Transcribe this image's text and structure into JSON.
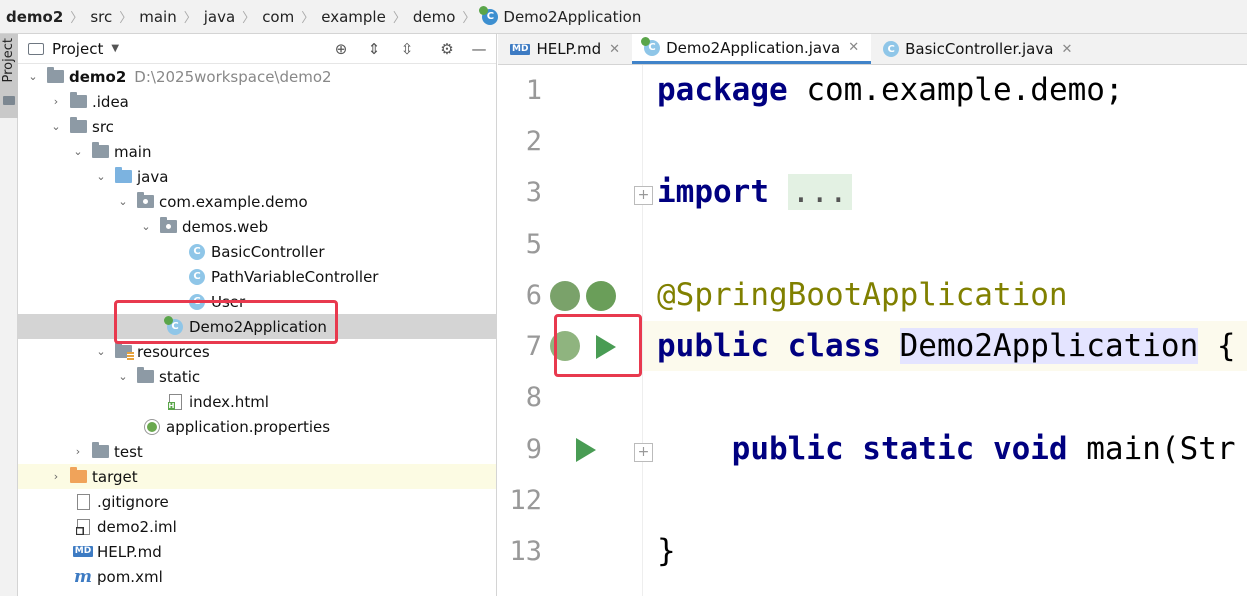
{
  "breadcrumb": [
    "demo2",
    "src",
    "main",
    "java",
    "com",
    "example",
    "demo",
    "Demo2Application"
  ],
  "tool_stripe": {
    "project_tab_label": "Project"
  },
  "project_panel": {
    "title": "Project",
    "tree": [
      {
        "label": "demo2",
        "path": "D:\\2025workspace\\demo2",
        "icon": "folder-icon",
        "expanded": true
      },
      {
        "label": ".idea",
        "icon": "folder-icon",
        "expanded": false
      },
      {
        "label": "src",
        "icon": "folder-icon",
        "expanded": true
      },
      {
        "label": "main",
        "icon": "folder-icon",
        "expanded": true
      },
      {
        "label": "java",
        "icon": "source-folder-icon",
        "expanded": true
      },
      {
        "label": "com.example.demo",
        "icon": "package-icon",
        "expanded": true
      },
      {
        "label": "demos.web",
        "icon": "package-icon",
        "expanded": true
      },
      {
        "label": "BasicController",
        "icon": "class-icon"
      },
      {
        "label": "PathVariableController",
        "icon": "class-icon"
      },
      {
        "label": "User",
        "icon": "class-icon"
      },
      {
        "label": "Demo2Application",
        "icon": "spring-class-icon",
        "selected": true
      },
      {
        "label": "resources",
        "icon": "resources-folder-icon",
        "expanded": true
      },
      {
        "label": "static",
        "icon": "folder-icon",
        "expanded": true
      },
      {
        "label": "index.html",
        "icon": "html-file-icon"
      },
      {
        "label": "application.properties",
        "icon": "spring-properties-icon"
      },
      {
        "label": "test",
        "icon": "folder-icon",
        "expanded": false
      },
      {
        "label": "target",
        "icon": "excluded-folder-icon",
        "expanded": false
      },
      {
        "label": ".gitignore",
        "icon": "file-icon"
      },
      {
        "label": "demo2.iml",
        "icon": "iml-file-icon"
      },
      {
        "label": "HELP.md",
        "icon": "markdown-icon"
      },
      {
        "label": "pom.xml",
        "icon": "maven-icon"
      }
    ]
  },
  "editor": {
    "tabs": [
      {
        "label": "HELP.md",
        "icon": "markdown-icon",
        "active": false
      },
      {
        "label": "Demo2Application.java",
        "icon": "spring-class-icon",
        "active": true
      },
      {
        "label": "BasicController.java",
        "icon": "class-icon",
        "active": false
      }
    ],
    "line_numbers": [
      "1",
      "2",
      "3",
      "5",
      "6",
      "7",
      "8",
      "9",
      "12",
      "13"
    ],
    "code": {
      "l1_kw": "package",
      "l1_rest": " com.example.demo;",
      "l3_kw": "import",
      "l3_fold": "...",
      "l6": "@SpringBootApplication",
      "l7_kw": "public class",
      "l7_name": "Demo2Application",
      "l7_rest": " {",
      "l9_kw": "public static void",
      "l9_rest": " main(Str",
      "l13": "}"
    }
  },
  "colors": {
    "keyword": "#000080",
    "annotation": "#808000",
    "selection": "#d4d4d4",
    "highlight_box": "#e8394e",
    "run": "#499c54",
    "active_tab_underline": "#4083c9"
  }
}
